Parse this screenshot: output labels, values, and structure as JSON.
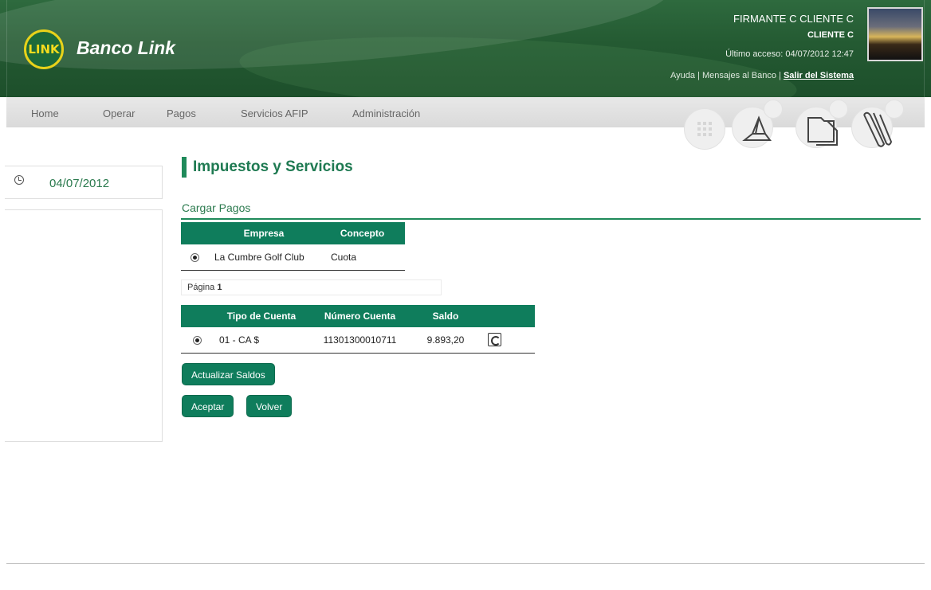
{
  "header": {
    "logo_text": "LINK",
    "brand": "Banco Link",
    "user_name": "FIRMANTE C CLIENTE C",
    "client": "CLIENTE C",
    "last_access": "Último acceso: 04/07/2012 12:47",
    "links": {
      "help": "Ayuda",
      "messages": "Mensajes al Banco",
      "exit": "Salir del Sistema",
      "separator": "|"
    }
  },
  "nav": {
    "items": [
      "Home",
      "Operar",
      "Pagos",
      "Servicios AFIP",
      "Administración"
    ],
    "icons": [
      "calculator-icon",
      "send-icon",
      "folder-icon",
      "paperclip-icon"
    ]
  },
  "sidebar": {
    "date": "04/07/2012"
  },
  "main": {
    "title": "Impuestos y Servicios",
    "section": "Cargar Pagos",
    "companies_table": {
      "headers": [
        "",
        "Empresa",
        "Concepto"
      ],
      "rows": [
        {
          "empresa": "La Cumbre Golf Club",
          "concepto": "Cuota",
          "selected": true
        }
      ]
    },
    "pager": {
      "label": "Página",
      "page": "1"
    },
    "accounts_table": {
      "headers": [
        "",
        "Tipo de Cuenta",
        "Número Cuenta",
        "Saldo",
        ""
      ],
      "rows": [
        {
          "tipo": "01 - CA $",
          "numero": "11301300010711",
          "saldo": "9.893,20",
          "selected": true
        }
      ]
    },
    "buttons": {
      "update": "Actualizar Saldos",
      "accept": "Aceptar",
      "back": "Volver"
    }
  },
  "colors": {
    "brand_green": "#0f7d5c",
    "header_green": "#245a32",
    "logo_yellow": "#e8d21a"
  }
}
